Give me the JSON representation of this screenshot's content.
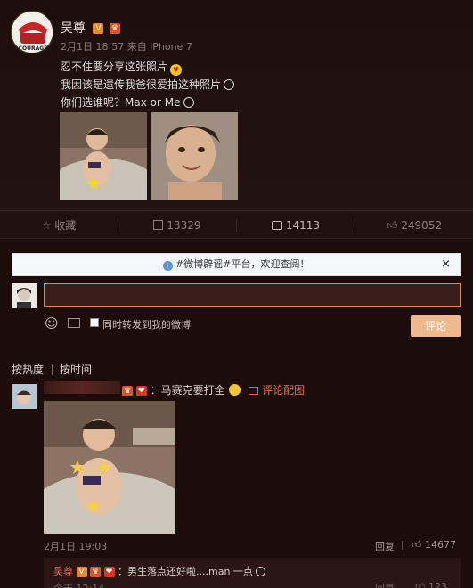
{
  "post": {
    "author": "吴尊",
    "time": "2月1日 18:57",
    "source_prefix": "来自",
    "source": "iPhone 7",
    "lines": [
      "忍不住要分享这张照片",
      "我因该是遗传我爸很爱拍这种照片",
      "你们选谁呢？Max or Me"
    ],
    "avatar_text": "COURAGE"
  },
  "actions": {
    "favorite": "收藏",
    "repost_count": "13329",
    "comment_count": "14113",
    "like_count": "249052"
  },
  "notice": {
    "text": "#微博辟谣#平台，欢迎查阅！",
    "close": "×"
  },
  "composer": {
    "repost_label": "同时转发到我的微博",
    "submit": "评论"
  },
  "sort": {
    "by_hot": "按热度",
    "by_time": "按时间"
  },
  "comment": {
    "text": "：马赛克要打全",
    "image_link": "评论配图",
    "time": "2月1日 19:03",
    "reply": "回复",
    "likes": "14677"
  },
  "sub_comment": {
    "author": "吴尊",
    "text": "：男生落点还好啦....man 一点",
    "time": "今天 12:14",
    "reply": "回复",
    "likes": "123"
  },
  "colors": {
    "accent": "#e06a2a",
    "submit_bg": "#f0b88f",
    "input_border": "#d48e3c"
  }
}
